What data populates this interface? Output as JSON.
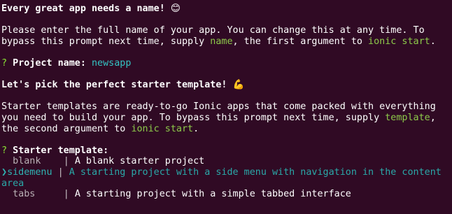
{
  "intro": {
    "heading": "Every great app needs a name! ",
    "heading_emoji": "😊",
    "text_1": "Please enter the full name of your app. You can change this at any time. To",
    "text_2a": "bypass this prompt next time, supply ",
    "text_2_code1": "name",
    "text_2b": ", the first argument to ",
    "text_2_code2": "ionic start",
    "text_2c": "."
  },
  "project_prompt": {
    "marker": "?",
    "label": " Project name: ",
    "value": "newsapp"
  },
  "template_intro": {
    "heading": "Let's pick the perfect starter template! ",
    "heading_emoji": "💪",
    "text_1": "Starter templates are ready-to-go Ionic apps that come packed with everything",
    "text_2a": "you need to build your app. To bypass this prompt next time, supply ",
    "text_2_code": "template",
    "text_2b": ",",
    "text_3a": "the second argument to ",
    "text_3_code": "ionic start",
    "text_3b": "."
  },
  "template_prompt": {
    "marker": "?",
    "label": " Starter template:",
    "pointer": "❯",
    "separator": "|",
    "options": [
      {
        "name": "blank",
        "description": "A blank starter project"
      },
      {
        "name": "sidemenu",
        "description": "A starting project with a side menu with navigation in the content",
        "wrap": "area"
      },
      {
        "name": "tabs",
        "description": "A starting project with a simple tabbed interface"
      }
    ]
  }
}
